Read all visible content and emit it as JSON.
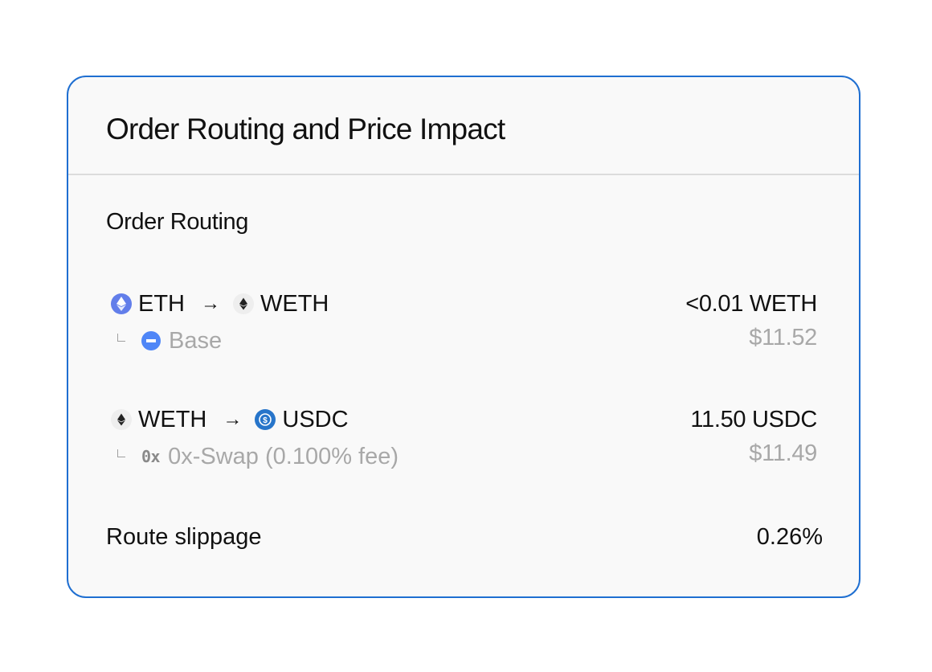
{
  "card": {
    "title": "Order Routing and Price Impact",
    "section_title": "Order Routing"
  },
  "routes": [
    {
      "from_token": "ETH",
      "from_icon": "eth-icon",
      "arrow": "→",
      "to_token": "WETH",
      "to_icon": "weth-icon",
      "via_icon": "base-icon",
      "via_label": "Base",
      "amount": "<0.01 WETH",
      "usd_value": "$11.52"
    },
    {
      "from_token": "WETH",
      "from_icon": "weth-icon",
      "arrow": "→",
      "to_token": "USDC",
      "to_icon": "usdc-icon",
      "via_icon": "0x-icon",
      "via_logo_text": "0x",
      "via_label": "0x-Swap (0.100% fee)",
      "amount": "11.50 USDC",
      "usd_value": "$11.49"
    }
  ],
  "slippage": {
    "label": "Route slippage",
    "value": "0.26%"
  },
  "colors": {
    "border": "#1f6fd1",
    "muted_text": "#a8a8a8",
    "eth": "#627eea",
    "usdc": "#2775ca",
    "base": "#4f86f7"
  }
}
